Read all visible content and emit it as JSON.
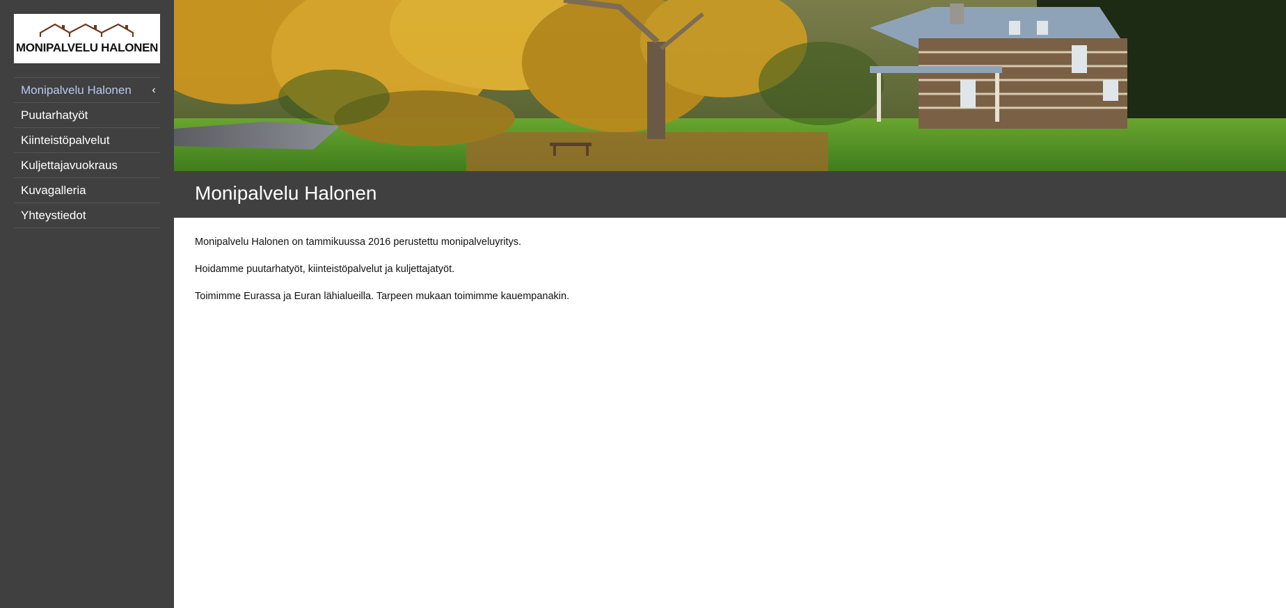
{
  "logo": {
    "text": "MONIPALVELU HALONEN",
    "icon": "roofs-logo-icon",
    "roof_color": "#6b3a1f"
  },
  "nav": {
    "items": [
      {
        "label": "Monipalvelu Halonen",
        "active": true,
        "icon": "chevron-left-icon"
      },
      {
        "label": "Puutarhatyöt"
      },
      {
        "label": "Kiinteistöpalvelut"
      },
      {
        "label": "Kuljettajavuokraus"
      },
      {
        "label": "Kuvagalleria"
      },
      {
        "label": "Yhteystiedot"
      }
    ],
    "chevron": "‹"
  },
  "page": {
    "title": "Monipalvelu Halonen",
    "paragraphs": [
      "Monipalvelu Halonen on tammikuussa 2016 perustettu monipalveluyritys.",
      "Hoidamme puutarhatyöt, kiinteistöpalvelut ja kuljettajatyöt.",
      "Toimimme Eurassa ja Euran lähialueilla. Tarpeen mukaan toimimme kauempanakin."
    ]
  },
  "colors": {
    "sidebar": "#404040",
    "active_link": "#b9c9ee",
    "title_bar": "#404040"
  }
}
